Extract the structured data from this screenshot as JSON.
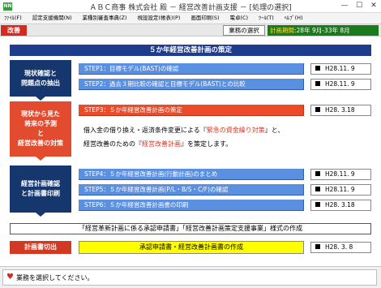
{
  "window": {
    "icon_text": "NN",
    "title": "ＡＢＣ商事 株式会社 殿 － 経営改善計画支援 － [処理の選択]",
    "minimize": "—",
    "maximize": "☐",
    "close": "✕"
  },
  "menu": [
    "ﾌｧｲﾙ(F)",
    "認定支援機関(N)",
    "業種別審査事典(Z)",
    "視設設定(帳表)(P)",
    "画面印刷(S)",
    "電卓(C)",
    "ﾂｰﾙ(T)",
    "ﾍﾙﾌﾟ(H)"
  ],
  "toolbar": {
    "badge": "改善",
    "select_button": "業務の選択",
    "period_label": "計画期間",
    "period_value": ":28年 9月-33年 8月"
  },
  "main": {
    "header": "５か年経営改善計画の策定",
    "phases": [
      "現状確認と\n問題点の抽出",
      "現状から見た\n将来の予測\nと\n経営改善の対策",
      "経営計画確認\nと計画書印刷"
    ],
    "steps": [
      {
        "label": "STEP1：目標モデル(BAST)の確認",
        "date": "H28.11. 9",
        "active": false
      },
      {
        "label": "STEP2：過去３期比較の確認と目標モデル(BAST)との比較",
        "date": "H28.11. 9",
        "active": false
      },
      {
        "label": "STEP3：５か年経営改善計画の策定",
        "date": "H28. 3.18",
        "active": true
      },
      {
        "label": "STEP4：５か年経営改善計画(行動計画)のまとめ",
        "date": "H28.11. 9",
        "active": false
      },
      {
        "label": "STEP5：５か年経営改善計画(P/L・B/S・C/F)の確認",
        "date": "H28.11. 9",
        "active": false
      },
      {
        "label": "STEP6：５か年経営改善計画書の印刷",
        "date": "H28. 3.18",
        "active": false
      }
    ],
    "description": {
      "line1_a": "借入金の借り換え・返済条件変更による『",
      "line1_red": "緊急の資金繰り対策",
      "line1_b": "』と、",
      "line2_a": "経営改善のための『",
      "line2_red": "経営改善計画",
      "line2_b": "』を策定します。"
    },
    "footer_banner": "「経営革新計画に係る承認申請書」「経営改善計画策定支援事業」様式の作成",
    "cutout_label": "計画書切出",
    "print_button": "承認申請書・経営改善計画書の作成",
    "print_date": "H28. 3. 8"
  },
  "status": {
    "text": "業務を選択してください。"
  },
  "icons": {
    "status": "heart-icon",
    "date_marker": "square-bullet-icon"
  },
  "colors": {
    "header_navy": "#1e3b8c",
    "phase_navy": "#16366e",
    "step_blue": "#5b8fe0",
    "active_red": "#ec4b2a",
    "badge_red": "#d42a20",
    "period_green": "#1b7a1b",
    "print_yellow": "#ffff00"
  }
}
